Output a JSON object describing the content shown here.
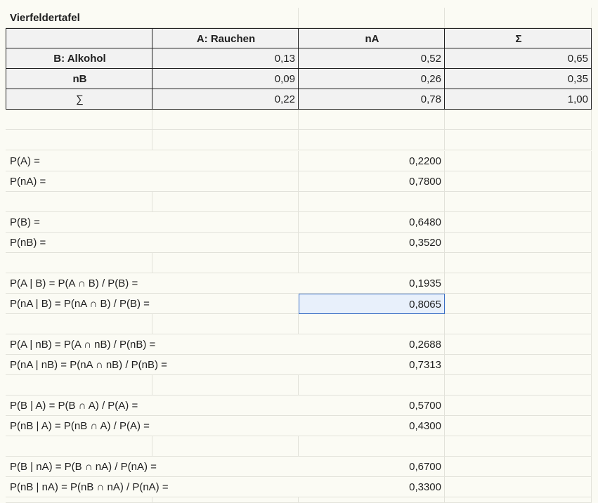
{
  "title": "Vierfeldertafel",
  "table": {
    "header": [
      "",
      "A: Rauchen",
      "nA",
      "Σ"
    ],
    "rows": [
      {
        "label": "B: Alkohol",
        "values": [
          "0,13",
          "0,52",
          "0,65"
        ]
      },
      {
        "label": "nB",
        "values": [
          "0,09",
          "0,26",
          "0,35"
        ]
      },
      {
        "label": "∑",
        "values": [
          "0,22",
          "0,78",
          "1,00"
        ]
      }
    ]
  },
  "probabilities": [
    {
      "label": "P(A) =",
      "value": "0,2200"
    },
    {
      "label": "P(nA) =",
      "value": "0,7800"
    },
    {
      "label": "P(B) =",
      "value": "0,6480"
    },
    {
      "label": "P(nB) =",
      "value": "0,3520"
    },
    {
      "label": "P(A | B) = P(A ∩ B) / P(B) =",
      "value": "0,1935"
    },
    {
      "label": "P(nA | B) = P(nA ∩ B) / P(B) =",
      "value": "0,8065"
    },
    {
      "label": "P(A | nB) = P(A ∩ nB) / P(nB) =",
      "value": "0,2688"
    },
    {
      "label": "P(nA | nB) = P(nA ∩ nB) / P(nB) =",
      "value": "0,7313"
    },
    {
      "label": "P(B | A) = P(B ∩ A) / P(A) =",
      "value": "0,5700"
    },
    {
      "label": "P(nB | A) = P(nB ∩ A) / P(A) =",
      "value": "0,4300"
    },
    {
      "label": "P(B | nA) = P(B ∩ nA) / P(nA) =",
      "value": "0,6700"
    },
    {
      "label": "P(nB | nA) = P(nB ∩ nA) / P(nA) =",
      "value": "0,3300"
    }
  ]
}
